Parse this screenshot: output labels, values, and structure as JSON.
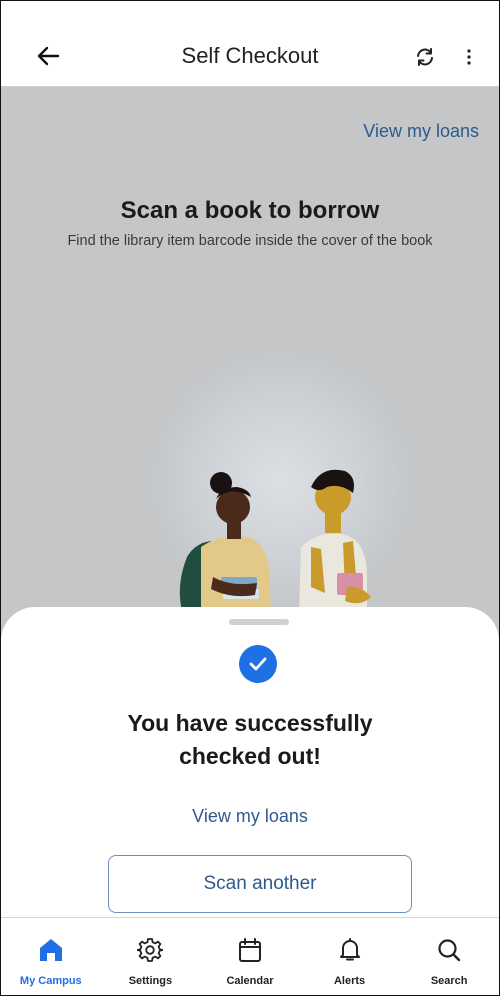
{
  "app_bar": {
    "title": "Self Checkout",
    "back_icon": "arrow-left-icon",
    "refresh_icon": "refresh-icon",
    "more_icon": "more-vertical-icon"
  },
  "content": {
    "view_loans_link": "View my loans",
    "heading": "Scan a book to borrow",
    "subheading": "Find the library item barcode inside the cover of the book"
  },
  "sheet": {
    "status_icon": "check-circle-icon",
    "message": "You have successfully checked out!",
    "view_loans_link": "View my loans",
    "scan_another_button": "Scan another"
  },
  "bottom_nav": {
    "items": [
      {
        "label": "My Campus",
        "icon": "home-icon",
        "active": true
      },
      {
        "label": "Settings",
        "icon": "gear-icon",
        "active": false
      },
      {
        "label": "Calendar",
        "icon": "calendar-icon",
        "active": false
      },
      {
        "label": "Alerts",
        "icon": "bell-icon",
        "active": false
      },
      {
        "label": "Search",
        "icon": "search-icon",
        "active": false
      }
    ]
  },
  "colors": {
    "accent": "#1f6fe5",
    "link": "#2e5a8e",
    "overlay": "#c4c6c8"
  }
}
